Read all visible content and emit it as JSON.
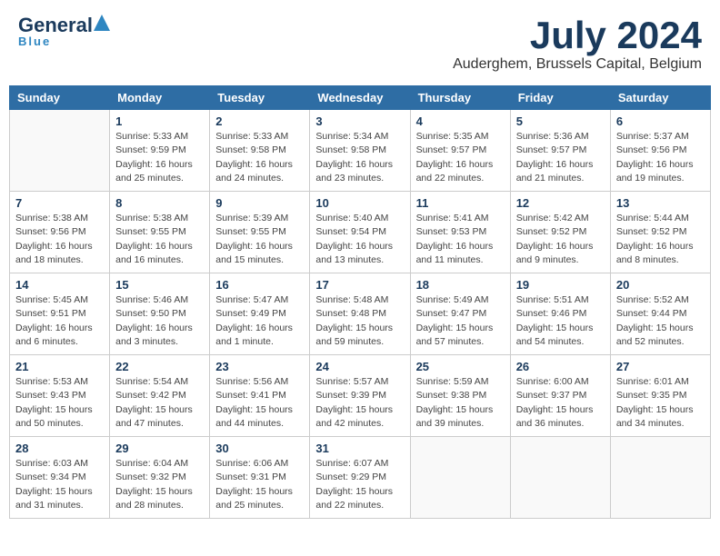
{
  "header": {
    "logo_general": "General",
    "logo_blue": "Blue",
    "month": "July 2024",
    "location": "Auderghem, Brussels Capital, Belgium"
  },
  "weekdays": [
    "Sunday",
    "Monday",
    "Tuesday",
    "Wednesday",
    "Thursday",
    "Friday",
    "Saturday"
  ],
  "weeks": [
    [
      {
        "day": "",
        "info": ""
      },
      {
        "day": "1",
        "info": "Sunrise: 5:33 AM\nSunset: 9:59 PM\nDaylight: 16 hours\nand 25 minutes."
      },
      {
        "day": "2",
        "info": "Sunrise: 5:33 AM\nSunset: 9:58 PM\nDaylight: 16 hours\nand 24 minutes."
      },
      {
        "day": "3",
        "info": "Sunrise: 5:34 AM\nSunset: 9:58 PM\nDaylight: 16 hours\nand 23 minutes."
      },
      {
        "day": "4",
        "info": "Sunrise: 5:35 AM\nSunset: 9:57 PM\nDaylight: 16 hours\nand 22 minutes."
      },
      {
        "day": "5",
        "info": "Sunrise: 5:36 AM\nSunset: 9:57 PM\nDaylight: 16 hours\nand 21 minutes."
      },
      {
        "day": "6",
        "info": "Sunrise: 5:37 AM\nSunset: 9:56 PM\nDaylight: 16 hours\nand 19 minutes."
      }
    ],
    [
      {
        "day": "7",
        "info": "Sunrise: 5:38 AM\nSunset: 9:56 PM\nDaylight: 16 hours\nand 18 minutes."
      },
      {
        "day": "8",
        "info": "Sunrise: 5:38 AM\nSunset: 9:55 PM\nDaylight: 16 hours\nand 16 minutes."
      },
      {
        "day": "9",
        "info": "Sunrise: 5:39 AM\nSunset: 9:55 PM\nDaylight: 16 hours\nand 15 minutes."
      },
      {
        "day": "10",
        "info": "Sunrise: 5:40 AM\nSunset: 9:54 PM\nDaylight: 16 hours\nand 13 minutes."
      },
      {
        "day": "11",
        "info": "Sunrise: 5:41 AM\nSunset: 9:53 PM\nDaylight: 16 hours\nand 11 minutes."
      },
      {
        "day": "12",
        "info": "Sunrise: 5:42 AM\nSunset: 9:52 PM\nDaylight: 16 hours\nand 9 minutes."
      },
      {
        "day": "13",
        "info": "Sunrise: 5:44 AM\nSunset: 9:52 PM\nDaylight: 16 hours\nand 8 minutes."
      }
    ],
    [
      {
        "day": "14",
        "info": "Sunrise: 5:45 AM\nSunset: 9:51 PM\nDaylight: 16 hours\nand 6 minutes."
      },
      {
        "day": "15",
        "info": "Sunrise: 5:46 AM\nSunset: 9:50 PM\nDaylight: 16 hours\nand 3 minutes."
      },
      {
        "day": "16",
        "info": "Sunrise: 5:47 AM\nSunset: 9:49 PM\nDaylight: 16 hours\nand 1 minute."
      },
      {
        "day": "17",
        "info": "Sunrise: 5:48 AM\nSunset: 9:48 PM\nDaylight: 15 hours\nand 59 minutes."
      },
      {
        "day": "18",
        "info": "Sunrise: 5:49 AM\nSunset: 9:47 PM\nDaylight: 15 hours\nand 57 minutes."
      },
      {
        "day": "19",
        "info": "Sunrise: 5:51 AM\nSunset: 9:46 PM\nDaylight: 15 hours\nand 54 minutes."
      },
      {
        "day": "20",
        "info": "Sunrise: 5:52 AM\nSunset: 9:44 PM\nDaylight: 15 hours\nand 52 minutes."
      }
    ],
    [
      {
        "day": "21",
        "info": "Sunrise: 5:53 AM\nSunset: 9:43 PM\nDaylight: 15 hours\nand 50 minutes."
      },
      {
        "day": "22",
        "info": "Sunrise: 5:54 AM\nSunset: 9:42 PM\nDaylight: 15 hours\nand 47 minutes."
      },
      {
        "day": "23",
        "info": "Sunrise: 5:56 AM\nSunset: 9:41 PM\nDaylight: 15 hours\nand 44 minutes."
      },
      {
        "day": "24",
        "info": "Sunrise: 5:57 AM\nSunset: 9:39 PM\nDaylight: 15 hours\nand 42 minutes."
      },
      {
        "day": "25",
        "info": "Sunrise: 5:59 AM\nSunset: 9:38 PM\nDaylight: 15 hours\nand 39 minutes."
      },
      {
        "day": "26",
        "info": "Sunrise: 6:00 AM\nSunset: 9:37 PM\nDaylight: 15 hours\nand 36 minutes."
      },
      {
        "day": "27",
        "info": "Sunrise: 6:01 AM\nSunset: 9:35 PM\nDaylight: 15 hours\nand 34 minutes."
      }
    ],
    [
      {
        "day": "28",
        "info": "Sunrise: 6:03 AM\nSunset: 9:34 PM\nDaylight: 15 hours\nand 31 minutes."
      },
      {
        "day": "29",
        "info": "Sunrise: 6:04 AM\nSunset: 9:32 PM\nDaylight: 15 hours\nand 28 minutes."
      },
      {
        "day": "30",
        "info": "Sunrise: 6:06 AM\nSunset: 9:31 PM\nDaylight: 15 hours\nand 25 minutes."
      },
      {
        "day": "31",
        "info": "Sunrise: 6:07 AM\nSunset: 9:29 PM\nDaylight: 15 hours\nand 22 minutes."
      },
      {
        "day": "",
        "info": ""
      },
      {
        "day": "",
        "info": ""
      },
      {
        "day": "",
        "info": ""
      }
    ]
  ]
}
